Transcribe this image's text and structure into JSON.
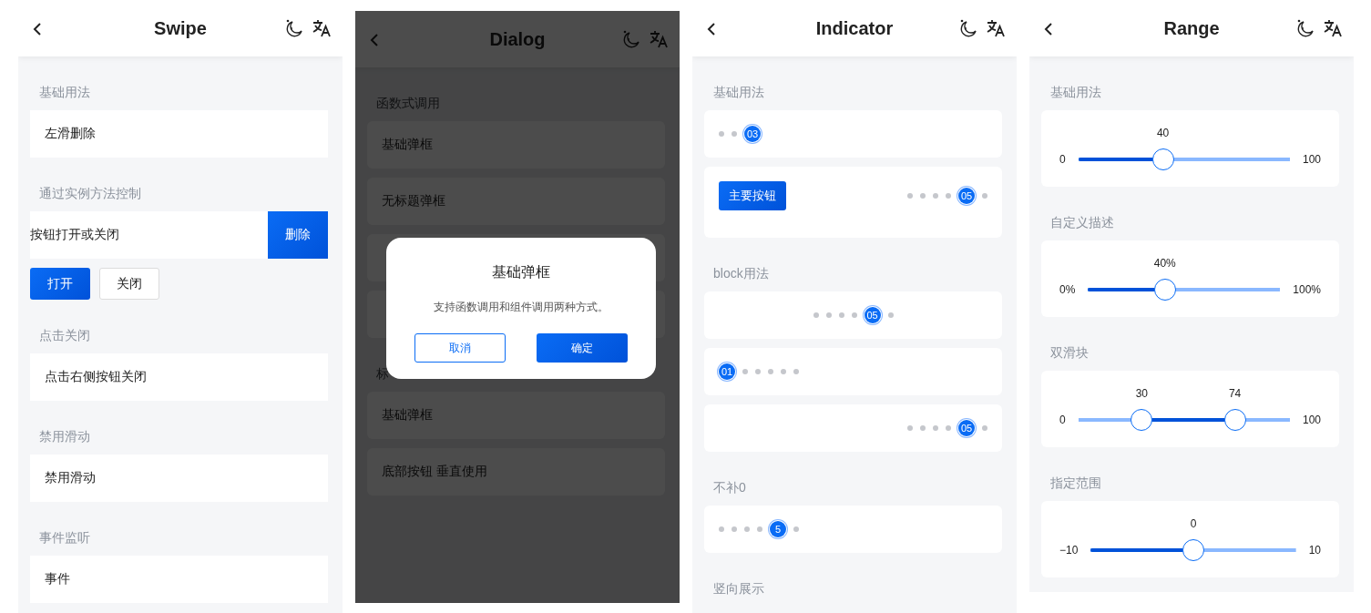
{
  "screens": [
    {
      "title": "Swipe",
      "sections": [
        {
          "title": "基础用法",
          "items": [
            {
              "kind": "cell",
              "text": "左滑删除"
            }
          ]
        },
        {
          "title": "通过实例方法控制",
          "items": [
            {
              "kind": "swipe",
              "text": "按钮打开或关闭",
              "action": "删除",
              "open": true
            },
            {
              "kind": "buttons",
              "buttons": [
                {
                  "label": "打开",
                  "kind": "primary"
                },
                {
                  "label": "关闭",
                  "kind": "default"
                }
              ]
            }
          ]
        },
        {
          "title": "点击关闭",
          "items": [
            {
              "kind": "cell",
              "text": "点击右侧按钮关闭"
            }
          ]
        },
        {
          "title": "禁用滑动",
          "items": [
            {
              "kind": "cell",
              "text": "禁用滑动"
            }
          ]
        },
        {
          "title": "事件监听",
          "items": [
            {
              "kind": "cell",
              "text": "事件"
            }
          ]
        }
      ]
    },
    {
      "title": "Dialog",
      "sections": [
        {
          "title": "函数式调用",
          "items": [
            {
              "kind": "cell",
              "text": "基础弹框"
            },
            {
              "kind": "cell",
              "text": "无标题弹框"
            },
            {
              "kind": "cell"
            },
            {
              "kind": "cell"
            }
          ]
        },
        {
          "title": "标",
          "items": [
            {
              "kind": "cell",
              "text": "基础弹框"
            },
            {
              "kind": "cell",
              "text": "底部按钮 垂直使用"
            }
          ]
        }
      ],
      "dialog": {
        "title": "基础弹框",
        "message": "支持函数调用和组件调用两种方式。",
        "buttons": [
          {
            "label": "取消",
            "kind": "outline"
          },
          {
            "label": "确定",
            "kind": "primary"
          }
        ]
      }
    },
    {
      "title": "Indicator",
      "sections": [
        {
          "title": "基础用法",
          "items": [
            {
              "kind": "indicator",
              "align_center": false,
              "align_right": false,
              "dots": [
                {
                  "selected": false
                },
                {
                  "selected": false
                },
                {
                  "selected": true,
                  "label": "03"
                }
              ]
            },
            {
              "kind": "indicator",
              "align_center": false,
              "align_right": true,
              "button": "主要按钮",
              "dots": [
                {
                  "selected": false
                },
                {
                  "selected": false
                },
                {
                  "selected": false
                },
                {
                  "selected": false
                },
                {
                  "selected": true,
                  "label": "05"
                },
                {
                  "selected": false
                }
              ]
            }
          ]
        },
        {
          "title": "block用法",
          "items": [
            {
              "kind": "indicator",
              "align_center": true,
              "align_right": false,
              "dots": [
                {
                  "selected": false
                },
                {
                  "selected": false
                },
                {
                  "selected": false
                },
                {
                  "selected": false
                },
                {
                  "selected": true,
                  "label": "05"
                },
                {
                  "selected": false
                }
              ]
            },
            {
              "kind": "indicator",
              "align_center": false,
              "align_right": false,
              "dots": [
                {
                  "selected": true,
                  "label": "01"
                },
                {
                  "selected": false
                },
                {
                  "selected": false
                },
                {
                  "selected": false
                },
                {
                  "selected": false
                },
                {
                  "selected": false
                }
              ]
            },
            {
              "kind": "indicator",
              "align_center": false,
              "align_right": true,
              "dots": [
                {
                  "selected": false
                },
                {
                  "selected": false
                },
                {
                  "selected": false
                },
                {
                  "selected": false
                },
                {
                  "selected": true,
                  "label": "05"
                },
                {
                  "selected": false
                }
              ]
            }
          ]
        },
        {
          "title": "不补0",
          "items": [
            {
              "kind": "indicator",
              "align_center": false,
              "align_right": false,
              "dots": [
                {
                  "selected": false
                },
                {
                  "selected": false
                },
                {
                  "selected": false
                },
                {
                  "selected": false
                },
                {
                  "selected": true,
                  "label": "5"
                },
                {
                  "selected": false
                }
              ]
            }
          ]
        },
        {
          "title": "竖向展示"
        }
      ]
    },
    {
      "title": "Range",
      "sections": [
        {
          "title": "基础用法",
          "items": [
            {
              "kind": "range",
              "min": "0",
              "max": "100",
              "thumbs": [
                {
                  "label": "40",
                  "level": 0.4
                }
              ]
            }
          ]
        },
        {
          "title": "自定义描述",
          "items": [
            {
              "kind": "range",
              "min": "0%",
              "max": "100%",
              "thumbs": [
                {
                  "label": "40%",
                  "level": 0.4
                }
              ]
            }
          ]
        },
        {
          "title": "双滑块",
          "items": [
            {
              "kind": "range",
              "min": "0",
              "max": "100",
              "thumbs": [
                {
                  "label": "30",
                  "level": 0.3
                },
                {
                  "label": "74",
                  "level": 0.74
                }
              ]
            }
          ]
        },
        {
          "title": "指定范围",
          "items": [
            {
              "kind": "range",
              "min": "−10",
              "max": "10",
              "thumbs": [
                {
                  "label": "0",
                  "level": 0.5
                }
              ]
            }
          ]
        }
      ]
    }
  ]
}
